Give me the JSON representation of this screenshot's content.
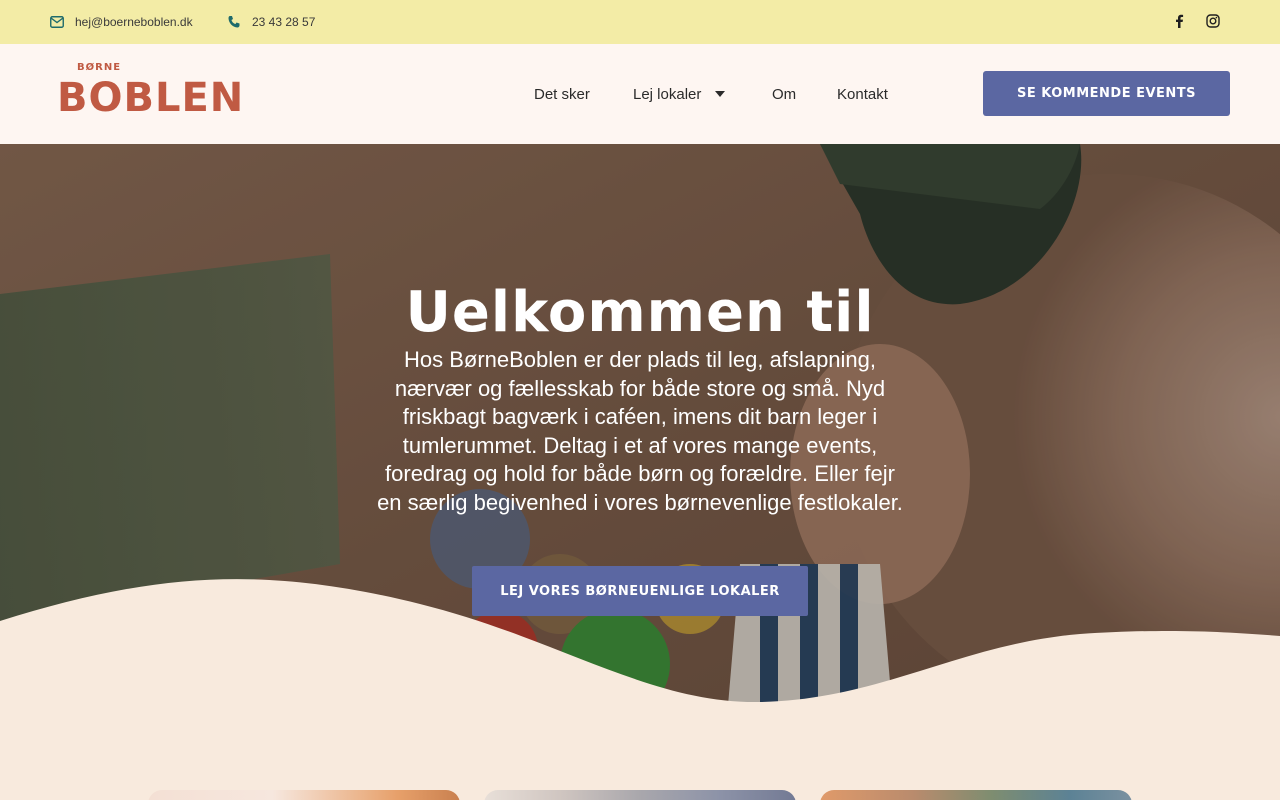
{
  "topbar": {
    "email": "hej@boerneboblen.dk",
    "phone": "23 43 28 57",
    "icons": {
      "email": "envelope-icon",
      "phone": "phone-icon",
      "facebook": "facebook-icon",
      "instagram": "instagram-icon"
    }
  },
  "header": {
    "logo": {
      "small": "BØRNE",
      "big": "BOBLEN"
    },
    "nav": [
      {
        "label": "Det sker"
      },
      {
        "label": "Lej lokaler"
      },
      {
        "label": "Om"
      },
      {
        "label": "Kontakt"
      }
    ],
    "cta": "SE KOMMENDE EVENTS"
  },
  "hero": {
    "title": "Uelkommen til",
    "text": "Hos BørneBoblen er der plads til leg, afslapning, nærvær og fællesskab for både store og små. Nyd friskbagt bagværk i caféen, imens dit barn leger i tumlerummet. Deltag i et af vores mange events, foredrag og hold for både børn og forældre. Eller fejr en særlig begivenhed i vores børnevenlige festlokaler.",
    "cta": "LEJ VORES BØRNEUENLIGE LOKALER"
  },
  "colors": {
    "topbar": "#f3eca6",
    "header": "#fef6f2",
    "accent": "#5b67a2",
    "logo": "#c05a43",
    "cream": "#f8eadd"
  }
}
